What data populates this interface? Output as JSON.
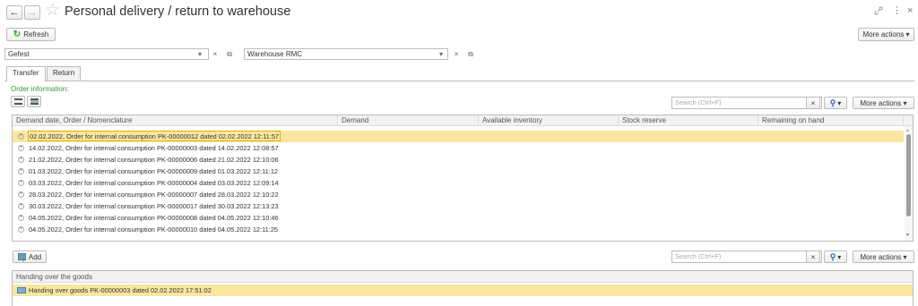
{
  "header": {
    "title": "Personal delivery / return to warehouse",
    "back_icon": "←",
    "forward_icon": "→",
    "star_icon": "☆",
    "link_icon": "🔗",
    "menu_icon": "⋮",
    "close_icon": "×"
  },
  "toolbar": {
    "refresh_label": "Refresh",
    "more_actions_label": "More actions ▾"
  },
  "fields": {
    "organization_value": "Gefest",
    "warehouse_value": "Warehouse RMC",
    "dropdown_glyph": "▾",
    "clear_glyph": "×",
    "open_glyph": "⧉"
  },
  "tabs": [
    {
      "label": "Transfer"
    },
    {
      "label": "Return"
    }
  ],
  "order_section": {
    "label": "Order information:",
    "search_placeholder": "Search (Ctrl+F)",
    "more_actions_label": "More actions ▾",
    "search_icon": "🔍",
    "columns": [
      "Demand date, Order / Nomenclature",
      "Demand",
      "Available inventory",
      "Stock reserve",
      "Remaining on hand"
    ],
    "rows": [
      "02.02.2022, Order for internal consumption PK-00000012 dated 02.02.2022 12:11:57",
      "14.02.2022, Order for internal consumption PK-00000003 dated 14.02.2022 12:08:57",
      "21.02.2022, Order for internal consumption PK-00000006 dated 21.02.2022 12:10:06",
      "01.03.2022, Order for internal consumption PK-00000009 dated 01.03.2022 12:11:12",
      "03.03.2022, Order for internal consumption PK-00000004 dated 03.03.2022 12:09:14",
      "28.03.2022, Order for internal consumption PK-00000007 dated 28.03.2022 12:10:22",
      "30.03.2022, Order for internal consumption PK-00000017 dated 30.03.2022 12:13:23",
      "04.05.2022, Order for internal consumption PK-00000008 dated 04.05.2022 12:10:46",
      "04.05.2022, Order for internal consumption PK-00000010 dated 04.05.2022 12:11:25"
    ]
  },
  "handover_section": {
    "add_label": "Add",
    "search_placeholder": "Search (Ctrl+F)",
    "more_actions_label": "More actions ▾",
    "column": "Handing over the goods",
    "rows": [
      "Handing over goods PK-00000003 dated 02.02.2022 17:51:02"
    ]
  },
  "colors": {
    "selected_row": "#fbe6a0",
    "accent_green": "#3a9a3a",
    "accent_blue": "#2a5db0"
  }
}
